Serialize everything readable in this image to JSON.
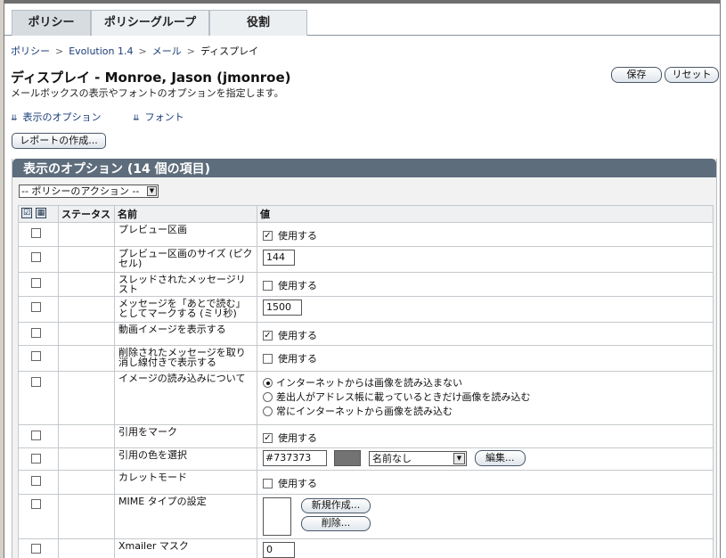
{
  "tabs": [
    {
      "label": "ポリシー",
      "active": true
    },
    {
      "label": "ポリシーグループ",
      "active": false
    },
    {
      "label": "役割",
      "active": false
    }
  ],
  "breadcrumb": {
    "items": [
      "ポリシー",
      "Evolution 1.4",
      "メール"
    ],
    "current": "ディスプレイ",
    "separator": ">"
  },
  "header": {
    "title": "ディスプレイ - Monroe, Jason (jmonroe)",
    "subtitle": "メールボックスの表示やフォントのオプションを指定します。",
    "save_label": "保存",
    "reset_label": "リセット"
  },
  "section_links": [
    "表示のオプション",
    "フォント"
  ],
  "report_button": "レポートの作成...",
  "panel": {
    "title": "表示のオプション (14 個の項目)",
    "action_select": "-- ポリシーのアクション --",
    "columns": {
      "status": "ステータス",
      "name": "名前",
      "value": "値"
    }
  },
  "use_label": "使用する",
  "rows": [
    {
      "name": "プレビュー区画",
      "type": "checkbox",
      "checked": true
    },
    {
      "name": "プレビュー区画のサイズ (ピクセル)",
      "type": "number",
      "value": "144"
    },
    {
      "name": "スレッドされたメッセージリスト",
      "type": "checkbox",
      "checked": false
    },
    {
      "name": "メッセージを「あとで読む」としてマークする (ミリ秒)",
      "type": "number",
      "value": "1500"
    },
    {
      "name": "動画イメージを表示する",
      "type": "checkbox",
      "checked": true
    },
    {
      "name": "削除されたメッセージを取り消し線付きで表示する",
      "type": "checkbox",
      "checked": false
    },
    {
      "name": "イメージの読み込みについて",
      "type": "radio",
      "options": [
        "インターネットからは画像を読み込まない",
        "差出人がアドレス帳に載っているときだけ画像を読み込む",
        "常にインターネットから画像を読み込む"
      ],
      "selected": 0
    },
    {
      "name": "引用をマーク",
      "type": "checkbox",
      "checked": true
    },
    {
      "name": "引用の色を選択",
      "type": "color",
      "value": "#737373",
      "swatch": "#737373",
      "select": "名前なし",
      "edit_label": "編集..."
    },
    {
      "name": "カレットモード",
      "type": "checkbox",
      "checked": false
    },
    {
      "name": "MIME タイプの設定",
      "type": "mime",
      "new_label": "新規作成...",
      "delete_label": "削除..."
    },
    {
      "name": "Xmailer マスク",
      "type": "number",
      "value": "0"
    }
  ]
}
